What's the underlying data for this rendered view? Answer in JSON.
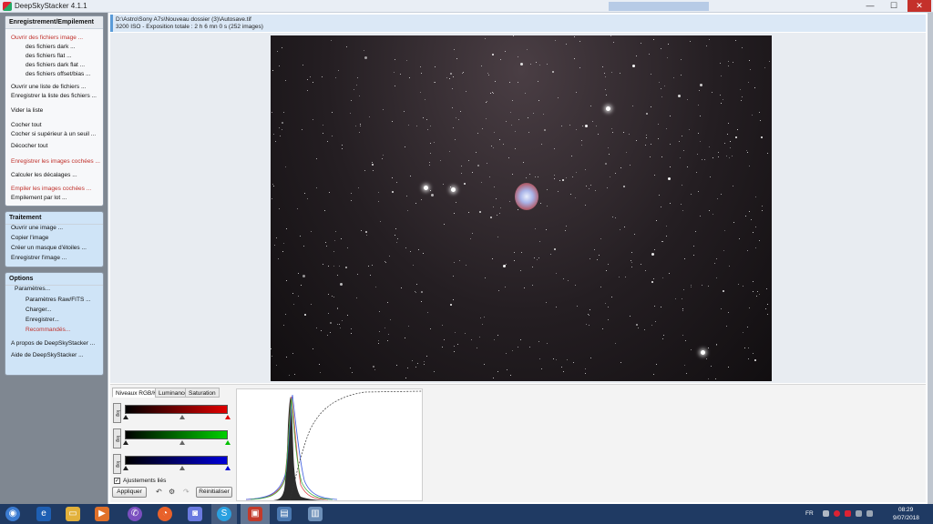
{
  "window": {
    "title": "DeepSkyStacker 4.1.1"
  },
  "sidebar": {
    "registration": {
      "header": "Enregistrement/Empilement",
      "items": [
        "Ouvrir des fichiers image ...",
        "des fichiers dark ...",
        "des fichiers flat ...",
        "des fichiers dark flat ...",
        "des fichiers offset/bias ...",
        "Ouvrir une liste de fichiers ...",
        "Enregistrer la liste des fichiers ...",
        "Vider la liste",
        "Cocher tout",
        "Cocher si supérieur à un seuil ...",
        "Décocher tout",
        "Enregistrer les images cochées ...",
        "Calculer les décalages ...",
        "Empiler les images cochées ...",
        "Empilement par lot ..."
      ]
    },
    "processing": {
      "header": "Traitement",
      "items": [
        "Ouvrir une image ...",
        "Copier l'image",
        "Créer un masque d'étoiles ...",
        "Enregistrer l'image ..."
      ]
    },
    "options": {
      "header": "Options",
      "items": [
        "Paramètres...",
        "Paramètres Raw/FITS ...",
        "Charger...",
        "Enregistrer...",
        "Recommandés...",
        "A propos de DeepSkyStacker ...",
        "Aide de DeepSkyStacker ..."
      ]
    }
  },
  "info": {
    "path": "D:\\Astro\\Sony A7s\\Nouveau dossier (3)\\Autosave.tif",
    "details": "3200 ISO - Exposition totale : 2 h 6 mn 0 s (252 images)"
  },
  "bottom": {
    "tabs": [
      "Niveaux RGB/K",
      "Luminance",
      "Saturation"
    ],
    "log_label": "log",
    "linked_label": "Ajustements liés",
    "linked_checked": true,
    "apply_label": "Appliquer",
    "reset_label": "Réinitialiser"
  },
  "taskbar": {
    "lang": "FR",
    "time": "08:29",
    "date": "9/07/2018"
  },
  "colors": {
    "sidebar_bg": "#7f8791",
    "group_blue": "#cfe4f7",
    "red_link": "#c0302a",
    "taskbar": "#1f3a63"
  }
}
